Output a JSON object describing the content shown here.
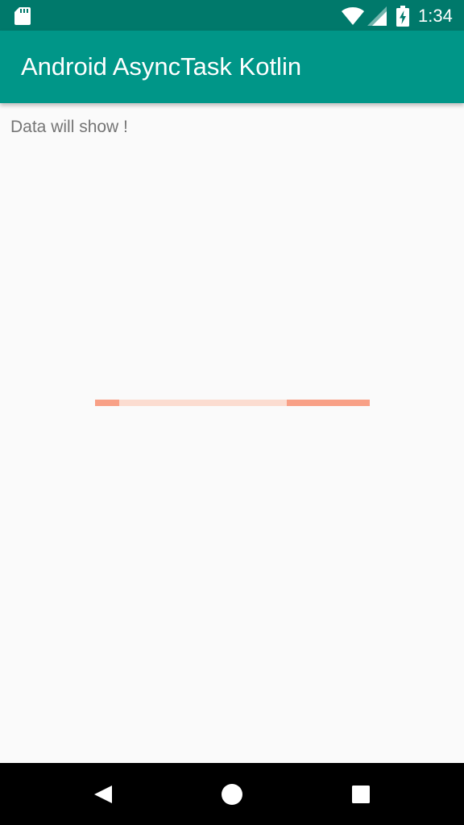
{
  "status_bar": {
    "time": "1:34",
    "icons": [
      "sd-card-icon",
      "wifi-icon",
      "signal-icon",
      "battery-charging-icon"
    ]
  },
  "app_bar": {
    "title": "Android AsyncTask Kotlin",
    "color": "#009688",
    "status_color": "#00796b"
  },
  "content": {
    "message": "Data will show !"
  },
  "progress": {
    "type": "indeterminate",
    "track_color": "#fbdcd0",
    "bar_color": "#f8a086"
  },
  "nav_bar": {
    "buttons": [
      "back-icon",
      "home-icon",
      "recents-icon"
    ]
  }
}
